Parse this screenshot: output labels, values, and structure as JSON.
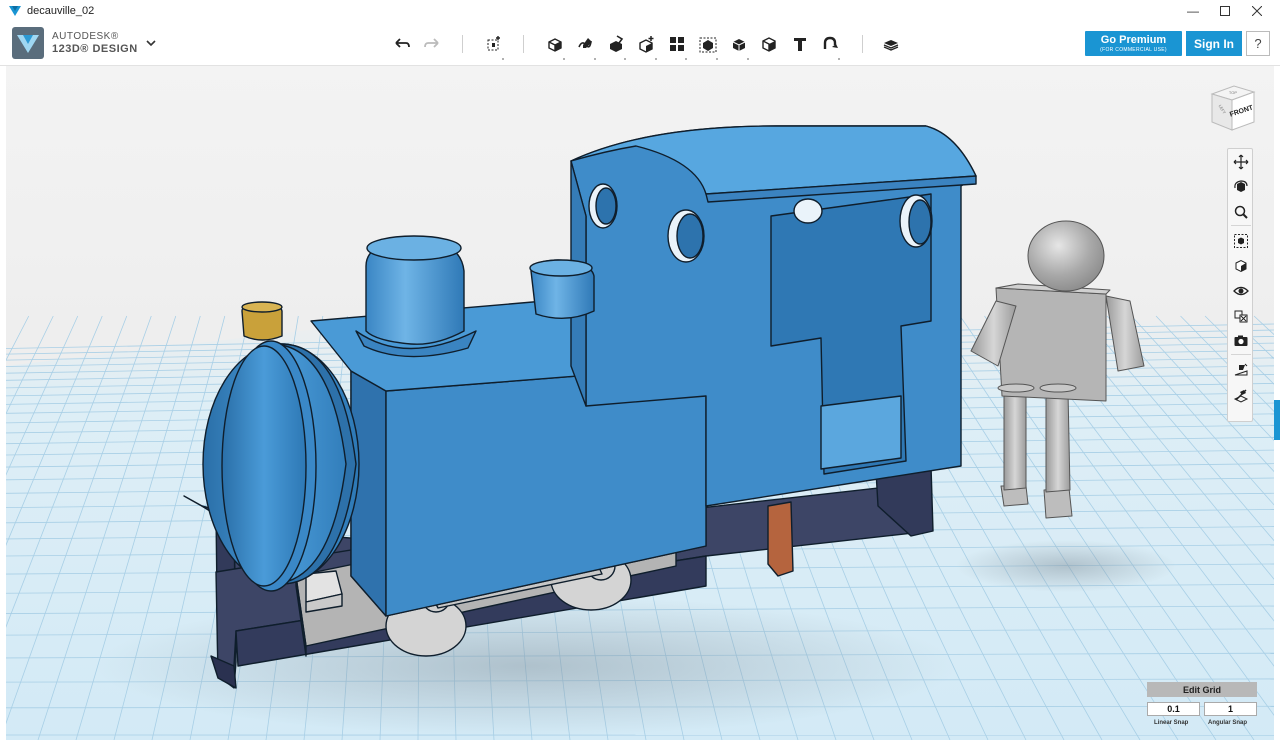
{
  "window": {
    "title": "decauville_02",
    "controls": [
      "minimize-icon",
      "maximize-icon",
      "close-icon"
    ]
  },
  "header": {
    "brand_line1": "AUTODESK®",
    "brand_line2": "123D® DESIGN",
    "toolbar": [
      "undo-icon",
      "redo-icon",
      "transform-icon",
      "primitives-icon",
      "sketch-icon",
      "construct-icon",
      "modify-icon",
      "pattern-icon",
      "group-icon",
      "combine-icon",
      "snap-icon",
      "measure-icon",
      "text-icon",
      "magnet-icon",
      "material-icon"
    ],
    "premium_label": "Go Premium",
    "premium_sub": "(FOR COMMERCIAL USE)",
    "signin_label": "Sign In",
    "help_label": "?"
  },
  "viewcube": {
    "face_label": "FRONT",
    "top_label": "TOP",
    "side_label": "LEFT"
  },
  "navbar": [
    "pan-icon",
    "orbit-icon",
    "zoom-icon",
    "fit-icon",
    "view-mode-icon",
    "visibility-icon",
    "materials-view-icon",
    "screenshot-icon",
    "snap-grid-icon",
    "grid-toggle-icon"
  ],
  "edit_grid": {
    "title": "Edit Grid",
    "linear_snap_value": "0.1",
    "angular_snap_value": "1",
    "linear_snap_label": "Linear Snap",
    "angular_snap_label": "Angular Snap"
  },
  "colors": {
    "accent": "#1a95d3",
    "body_blue": "#3f8cc9",
    "frame_navy": "#3d4566",
    "grid_line": "#a8cfe6",
    "grid_bg": "#dbeef7"
  }
}
